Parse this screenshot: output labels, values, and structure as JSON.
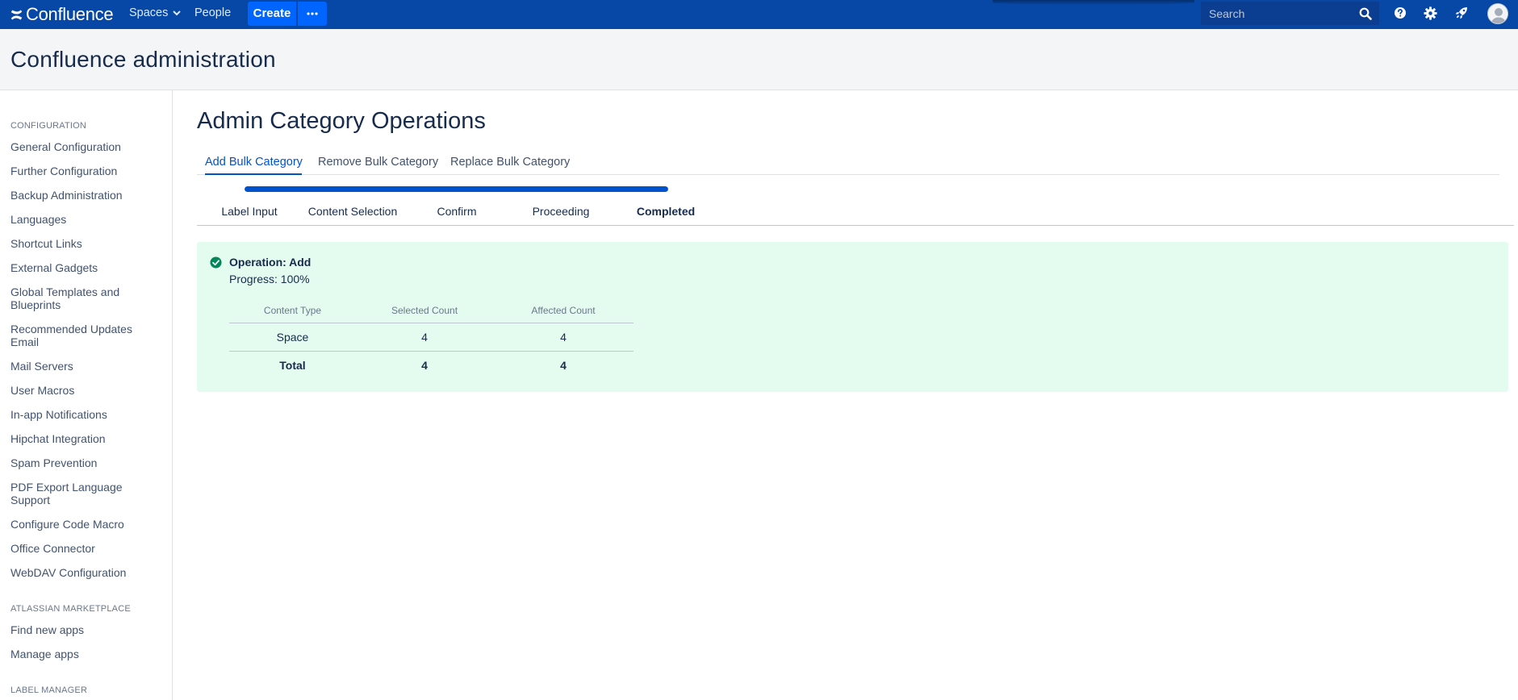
{
  "topbar": {
    "logo_text": "Confluence",
    "spaces_label": "Spaces",
    "people_label": "People",
    "create_label": "Create",
    "search_placeholder": "Search",
    "icons": [
      "confluence-logo-icon",
      "chevron-down-icon",
      "more-icon",
      "search-icon",
      "help-icon",
      "gear-icon",
      "rocket-icon",
      "avatar"
    ],
    "bar_color": "#0747a6",
    "accent_color": "#0065ff"
  },
  "admin_header": {
    "title": "Confluence administration"
  },
  "sidebar": {
    "sections": [
      {
        "title": "CONFIGURATION",
        "items": [
          "General Configuration",
          "Further Configuration",
          "Backup Administration",
          "Languages",
          "Shortcut Links",
          "External Gadgets",
          "Global Templates and Blueprints",
          "Recommended Updates Email",
          "Mail Servers",
          "User Macros",
          "In-app Notifications",
          "Hipchat Integration",
          "Spam Prevention",
          "PDF Export Language Support",
          "Configure Code Macro",
          "Office Connector",
          "WebDAV Configuration"
        ]
      },
      {
        "title": "ATLASSIAN MARKETPLACE",
        "items": [
          "Find new apps",
          "Manage apps"
        ]
      },
      {
        "title": "LABEL MANAGER",
        "items": []
      }
    ]
  },
  "main": {
    "title": "Admin Category Operations",
    "tabs": [
      {
        "label": "Add Bulk Category",
        "active": true
      },
      {
        "label": "Remove Bulk Category",
        "active": false
      },
      {
        "label": "Replace Bulk Category",
        "active": false
      }
    ],
    "wizard": {
      "progress_fraction": 1.0,
      "steps": [
        "Label Input",
        "Content Selection",
        "Confirm",
        "Proceeding",
        "Completed"
      ],
      "current_step": "Completed"
    },
    "result": {
      "status_icon": "check-circle-icon",
      "operation": "Operation: Add",
      "progress": "Progress: 100%",
      "columns": [
        "Content Type",
        "Selected Count",
        "Affected Count"
      ],
      "rows": [
        [
          "Space",
          "4",
          "4"
        ]
      ],
      "total": [
        "Total",
        "4",
        "4"
      ],
      "panel_color": "#e3fcef",
      "success_color": "#00875a"
    }
  }
}
